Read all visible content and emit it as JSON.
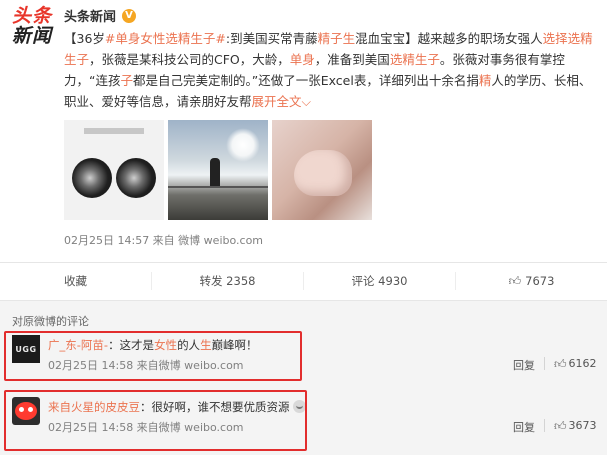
{
  "logo": {
    "line1": "头条",
    "line2": "新闻"
  },
  "author": {
    "name": "头条新闻",
    "verified_badge": "V"
  },
  "post": {
    "open_bracket": "【",
    "age": "36岁",
    "hashtag": "#单身女性选精生子#",
    "headline": ":到美国买常青藤",
    "headline_hl": "精子生",
    "headline_end": "混血宝宝",
    "close_bracket": "】",
    "seg1": "越来越多的职场女强人",
    "hl1": "选择选精生子",
    "seg2": "，张薇是某科技公司的CFO，大龄，",
    "hl2": "单身",
    "seg3": "，准备到美国",
    "hl3": "选精生子",
    "seg4": "。张薇对事务很有掌控力，“连孩",
    "hl4": "子",
    "seg5": "都是自己完美定制的。”还做了一张Excel表，详细列出十余名捐",
    "hl5": "精",
    "seg6": "人的学历、长相、职业、爱好等信息，请亲朋好友帮",
    "expand": "展开全文",
    "expand_icon": "chevron-down-icon",
    "meta": "02月25日 14:57 来自 微博 weibo.com"
  },
  "actions": {
    "collect": "收藏",
    "repost": "转发 2358",
    "comment": "评论 4930",
    "like": "7673"
  },
  "comments_header": "对原微博的评论",
  "comments": [
    {
      "avatar_text": "UGG",
      "user": "广_东-阿苗-",
      "text_pre": "：这才是",
      "text_hl1": "女性",
      "text_mid": "的人",
      "text_hl2": "生",
      "text_post": "巅峰啊！",
      "meta": "02月25日 14:58 来自微博 weibo.com",
      "reply": "回复",
      "likes": "6162"
    },
    {
      "user": "来自火星的皮皮豆",
      "text": "：很好啊，谁不想要优质资源",
      "meta": "02月25日 14:58 来自微博 weibo.com",
      "reply": "回复",
      "likes": "3673"
    }
  ],
  "colors": {
    "accent": "#eb7350",
    "logo_red": "#e8352a",
    "annotation_red": "#e22d2d",
    "verified": "#f5a623"
  }
}
